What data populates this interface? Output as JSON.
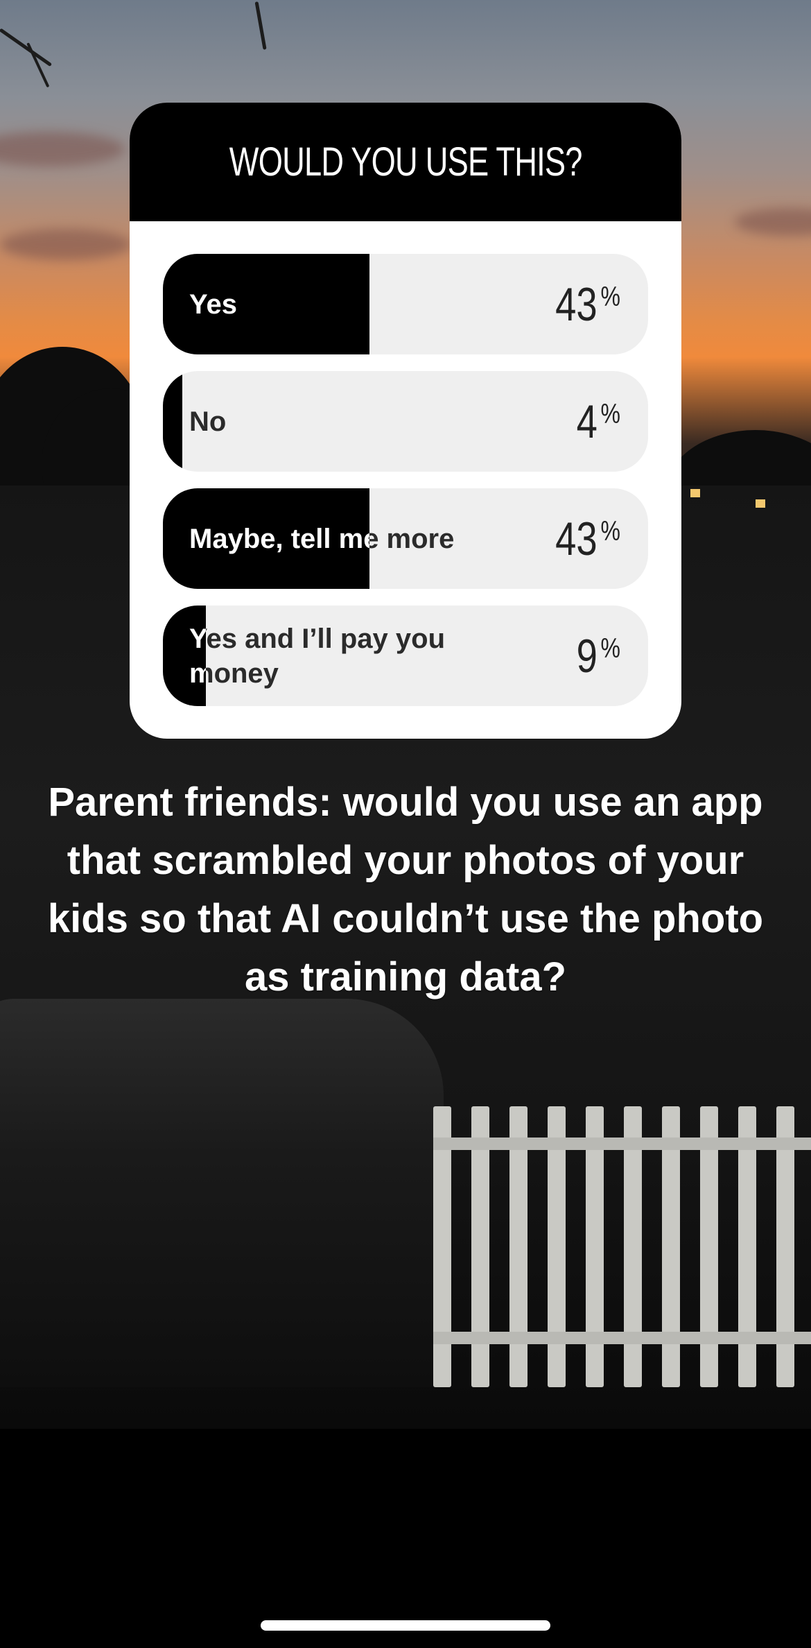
{
  "poll": {
    "question": "WOULD YOU USE THIS?",
    "options": [
      {
        "label": "Yes",
        "percent": 43
      },
      {
        "label": "No",
        "percent": 4
      },
      {
        "label": "Maybe, tell me more",
        "percent": 43
      },
      {
        "label": "Yes and I’ll pay you money",
        "percent": 9
      }
    ],
    "percent_sign": "%"
  },
  "caption": "Parent friends: would you use an app that scrambled your photos of your kids so that AI couldn’t use the photo as training data?",
  "colors": {
    "card_background": "#ffffff",
    "header_background": "#000000",
    "bar_fill": "#000000",
    "bar_track": "#efefef",
    "caption_text": "#ffffff"
  }
}
